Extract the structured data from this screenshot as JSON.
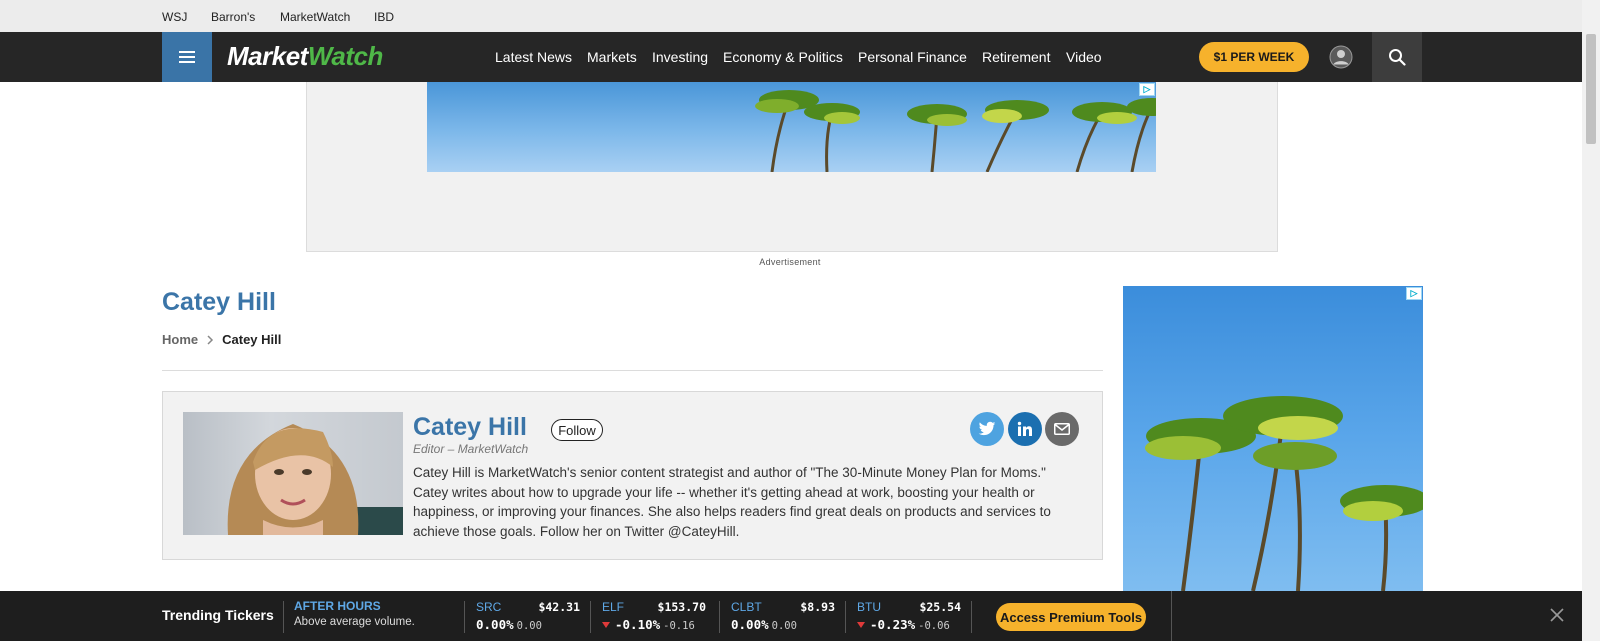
{
  "brands": [
    "WSJ",
    "Barron's",
    "MarketWatch",
    "IBD"
  ],
  "logo": {
    "part1": "Market",
    "part2": "Watch"
  },
  "nav": {
    "items": [
      "Latest News",
      "Markets",
      "Investing",
      "Economy & Politics",
      "Personal Finance",
      "Retirement",
      "Video"
    ],
    "subscribe_label": "$1 PER WEEK"
  },
  "ads": {
    "label": "Advertisement"
  },
  "page": {
    "title": "Catey Hill",
    "breadcrumb": {
      "home": "Home",
      "current": "Catey Hill"
    }
  },
  "author": {
    "name": "Catey Hill",
    "follow_label": "Follow",
    "role": "Editor  – MarketWatch",
    "bio": "Catey Hill is MarketWatch's senior content strategist and author of \"The 30-Minute Money Plan for Moms.\" Catey writes about how to upgrade your life -- whether it's getting ahead at work, boosting your health or happiness, or improving your finances. She also helps readers find great deals on products and services to achieve those goals. Follow her on Twitter @CateyHill."
  },
  "social_icons": [
    "twitter-icon",
    "linkedin-icon",
    "email-icon"
  ],
  "trending": {
    "title": "Trending Tickers",
    "after_hours_title": "AFTER HOURS",
    "after_hours_sub": "Above average volume.",
    "tickers": [
      {
        "symbol": "SRC",
        "price": "$42.31",
        "change_pct": "0.00%",
        "change": "0.00",
        "direction": "flat"
      },
      {
        "symbol": "ELF",
        "price": "$153.70",
        "change_pct": "-0.10%",
        "change": "-0.16",
        "direction": "down"
      },
      {
        "symbol": "CLBT",
        "price": "$8.93",
        "change_pct": "0.00%",
        "change": "0.00",
        "direction": "flat"
      },
      {
        "symbol": "BTU",
        "price": "$25.54",
        "change_pct": "-0.23%",
        "change": "-0.06",
        "direction": "down"
      }
    ],
    "premium_label": "Access Premium Tools"
  },
  "colors": {
    "brand_blue": "#3b75a8",
    "nav_bg": "#262626",
    "accent_yellow": "#f6b22c",
    "ticker_blue": "#5fa8e6",
    "down_red": "#e03a3a",
    "twitter": "#4ea3e0",
    "linkedin": "#1b6fb0",
    "email": "#6a6a6a"
  }
}
